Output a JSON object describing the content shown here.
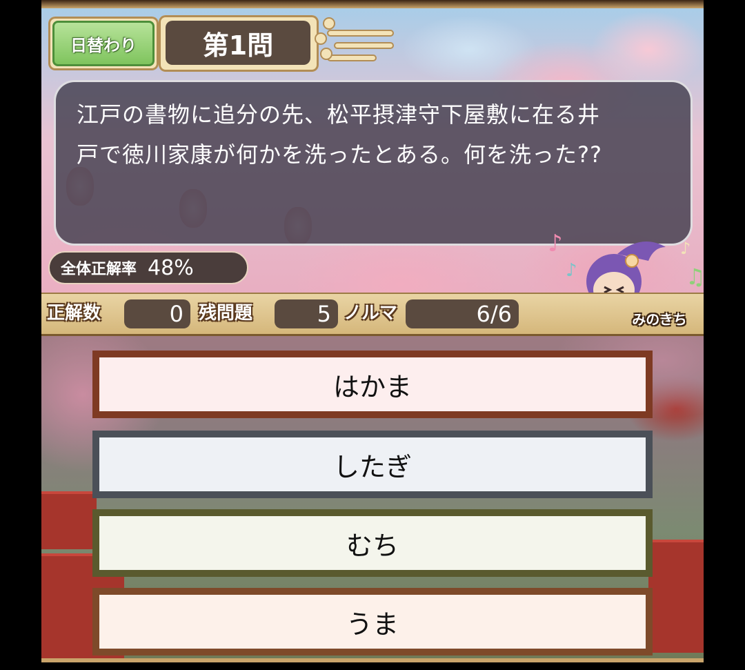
{
  "header": {
    "daily_label": "日替わり",
    "question_number": "第1問"
  },
  "question": {
    "line1": "江戸の書物に追分の先、松平摂津守下屋敷に在る井",
    "line2": "戸で徳川家康が何かを洗ったとある。何を洗った??"
  },
  "accuracy": {
    "label": "全体正解率",
    "value": "48%"
  },
  "stats": {
    "correct_label": "正解数",
    "correct_value": "0",
    "remaining_label": "残問題",
    "remaining_value": "5",
    "quota_label": "ノルマ",
    "quota_value": "6/6"
  },
  "mascot": {
    "name": "みのきち"
  },
  "answers": [
    {
      "label": "はかま",
      "border": "#7e3a23",
      "fill": "#fdeeee"
    },
    {
      "label": "したぎ",
      "border": "#4b5058",
      "fill": "#eef1f5"
    },
    {
      "label": "むち",
      "border": "#5a5a2e",
      "fill": "#f4f5ec"
    },
    {
      "label": "うま",
      "border": "#7e4a2a",
      "fill": "#fdf1ea"
    }
  ]
}
